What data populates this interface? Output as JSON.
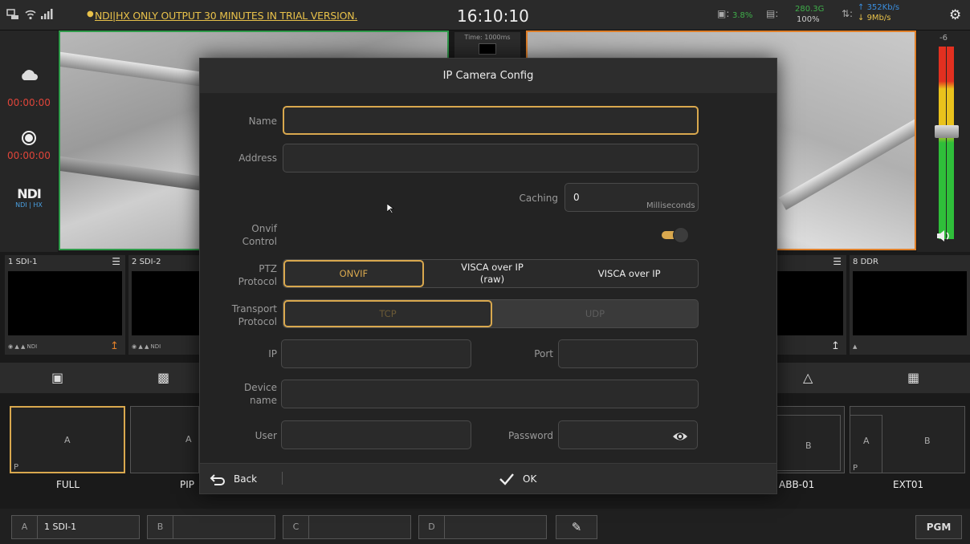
{
  "topbar": {
    "trial_notice": "NDI|HX ONLY OUTPUT 30 MINUTES IN TRIAL VERSION.",
    "clock": "16:10:10",
    "cpu": "3.8%",
    "storage_free": "280.3G",
    "storage_pct": "100%",
    "upload": "352Kb/s",
    "download": "9Mb/s",
    "icons": [
      "network-icon",
      "wifi-icon",
      "signal-icon",
      "bell-icon",
      "cpu-icon",
      "storage-icon",
      "transfer-icon",
      "gear-icon"
    ]
  },
  "side": {
    "stream_time": "00:00:00",
    "record_time": "00:00:00",
    "ndi_logo": "NDI",
    "ndi_sub": "NDI | HX"
  },
  "timecode": "Time: 1000ms",
  "audio": {
    "level": "-6"
  },
  "sources": [
    {
      "num": "1",
      "name": "SDI-1"
    },
    {
      "num": "2",
      "name": "SDI-2"
    },
    {
      "num": "8",
      "name": "DDR"
    }
  ],
  "layouts": [
    {
      "label": "FULL",
      "cell_a": "A",
      "corner": "P"
    },
    {
      "label": "PIP",
      "cell_a": "A"
    },
    {
      "label": "ABB-01",
      "cell_b": "B"
    },
    {
      "label": "EXT01",
      "cell_a": "A",
      "cell_b": "B",
      "corner": "P"
    }
  ],
  "bottom": {
    "slots": [
      {
        "key": "A",
        "value": "1 SDI-1"
      },
      {
        "key": "B",
        "value": ""
      },
      {
        "key": "C",
        "value": ""
      },
      {
        "key": "D",
        "value": ""
      }
    ],
    "pgm": "PGM"
  },
  "dialog": {
    "title": "IP Camera Config",
    "name_label": "Name",
    "name_value": "",
    "address_label": "Address",
    "address_value": "",
    "caching_label": "Caching",
    "caching_value": "0",
    "caching_unit": "Milliseconds",
    "onvif_label_1": "Onvif",
    "onvif_label_2": "Control",
    "onvif_enabled": true,
    "ptz_label_1": "PTZ",
    "ptz_label_2": "Protocol",
    "ptz_options": [
      "ONVIF",
      "VISCA over IP\n(raw)",
      "VISCA over IP"
    ],
    "ptz_selected": "ONVIF",
    "transport_label_1": "Transport",
    "transport_label_2": "Protocol",
    "transport_options": [
      "TCP",
      "UDP"
    ],
    "transport_selected": "TCP",
    "ip_label": "IP",
    "ip_value": "",
    "port_label": "Port",
    "port_value": "",
    "device_label_1": "Device",
    "device_label_2": "name",
    "device_value": "",
    "user_label": "User",
    "user_value": "",
    "password_label": "Password",
    "password_value": "",
    "back_label": "Back",
    "ok_label": "OK"
  },
  "colors": {
    "accent": "#d9a84e",
    "preview_border": "#2f9a4a",
    "program_border": "#e0802a",
    "alert": "#e8c14a",
    "record_time": "#e0453a"
  }
}
